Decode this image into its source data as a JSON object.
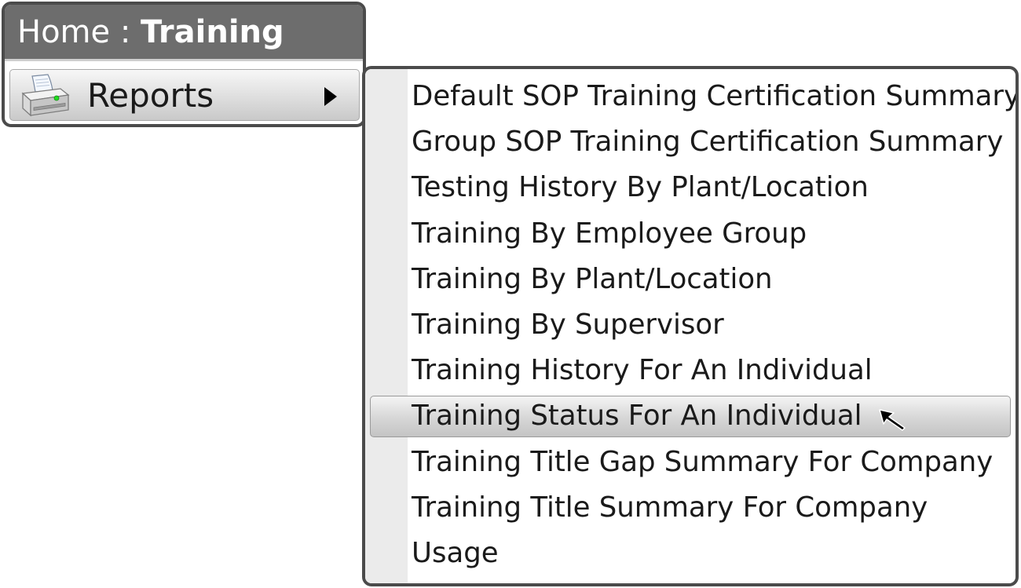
{
  "breadcrumb": {
    "home": "Home",
    "separator": " : ",
    "current": "Training"
  },
  "sidebar": {
    "reports": {
      "label": "Reports",
      "icon": "printer-icon",
      "arrow_icon": "chevron-right-icon"
    }
  },
  "submenu": {
    "items": [
      {
        "label": "Default SOP Training Certification Summary",
        "highlighted": false
      },
      {
        "label": "Group SOP Training Certification Summary",
        "highlighted": false
      },
      {
        "label": "Testing History By Plant/Location",
        "highlighted": false
      },
      {
        "label": "Training By Employee Group",
        "highlighted": false
      },
      {
        "label": "Training By Plant/Location",
        "highlighted": false
      },
      {
        "label": "Training By Supervisor",
        "highlighted": false
      },
      {
        "label": "Training History For An Individual",
        "highlighted": false
      },
      {
        "label": "Training Status For An Individual",
        "highlighted": true
      },
      {
        "label": "Training Title Gap Summary For Company",
        "highlighted": false
      },
      {
        "label": "Training Title Summary For Company",
        "highlighted": false
      },
      {
        "label": "Usage",
        "highlighted": false
      }
    ]
  },
  "colors": {
    "header_bg": "#6d6d6d",
    "border": "#4b4b4b",
    "gutter": "#ebebeb",
    "printer_led": "#22dd22"
  }
}
